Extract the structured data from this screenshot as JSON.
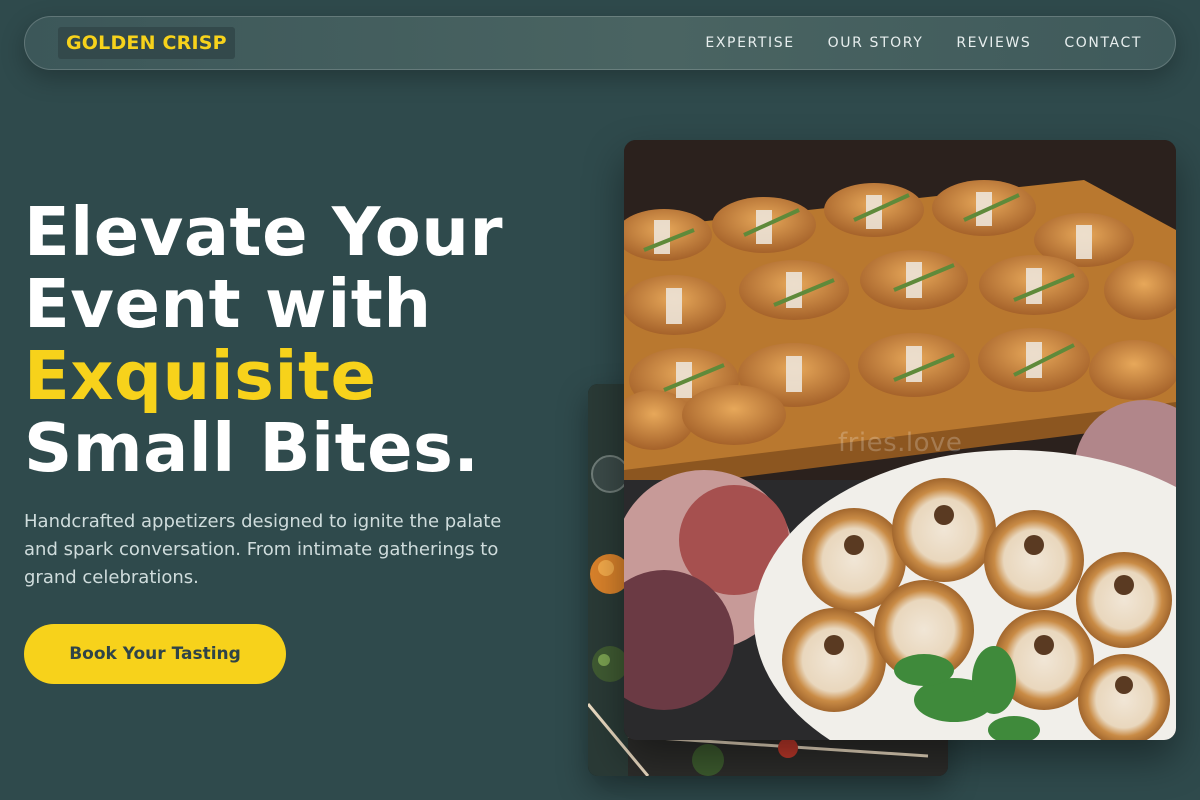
{
  "brand": {
    "name": "GOLDEN CRISP",
    "color": "#f7d21b"
  },
  "nav": {
    "links": [
      "EXPERTISE",
      "OUR STORY",
      "REVIEWS",
      "CONTACT"
    ]
  },
  "hero": {
    "title_line1": "Elevate Your",
    "title_line2": "Event with",
    "title_accent": "Exquisite",
    "title_line4": "Small Bites.",
    "subtitle": "Handcrafted appetizers designed to ignite the palate and spark conversation. From intimate gatherings to grand celebrations.",
    "cta_label": "Book Your Tasting"
  },
  "images": {
    "front": "croissant-sandwiches-and-tartlets-photo",
    "back": "appetizer-table-photo",
    "watermark": "fries.love"
  },
  "colors": {
    "background": "#2f4a4c",
    "accent": "#f7d21b",
    "text": "#ffffff",
    "muted_text": "#cfdcdc"
  }
}
